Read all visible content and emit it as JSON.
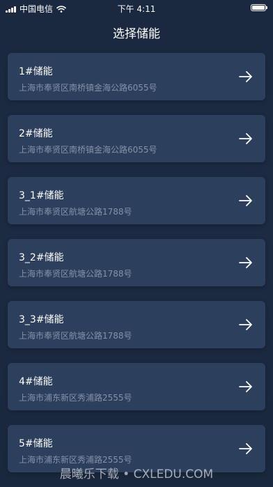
{
  "status_bar": {
    "carrier": "中国电信",
    "time": "下午 4:11"
  },
  "header": {
    "title": "选择储能"
  },
  "items": [
    {
      "name": "1#储能",
      "address": "上海市奉贤区南桥镇金海公路6055号"
    },
    {
      "name": "2#储能",
      "address": "上海市奉贤区南桥镇金海公路6055号"
    },
    {
      "name": "3_1#储能",
      "address": "上海市奉贤区航塘公路1788号"
    },
    {
      "name": "3_2#储能",
      "address": "上海市奉贤区航塘公路1788号"
    },
    {
      "name": "3_3#储能",
      "address": "上海市奉贤区航塘公路1788号"
    },
    {
      "name": "4#储能",
      "address": "上海市浦东新区秀浦路2555号"
    },
    {
      "name": "5#储能",
      "address": "上海市浦东新区秀浦路2555号"
    }
  ],
  "watermark": "晨曦乐下载 • CXLEDU.COM",
  "colors": {
    "background": "#1c2a42",
    "card": "#2c3f5d",
    "secondary_text": "#8592a8"
  },
  "icons": {
    "row_action": "arrow-right-icon",
    "wifi": "wifi-icon",
    "signal": "signal-icon",
    "battery": "battery-icon"
  }
}
